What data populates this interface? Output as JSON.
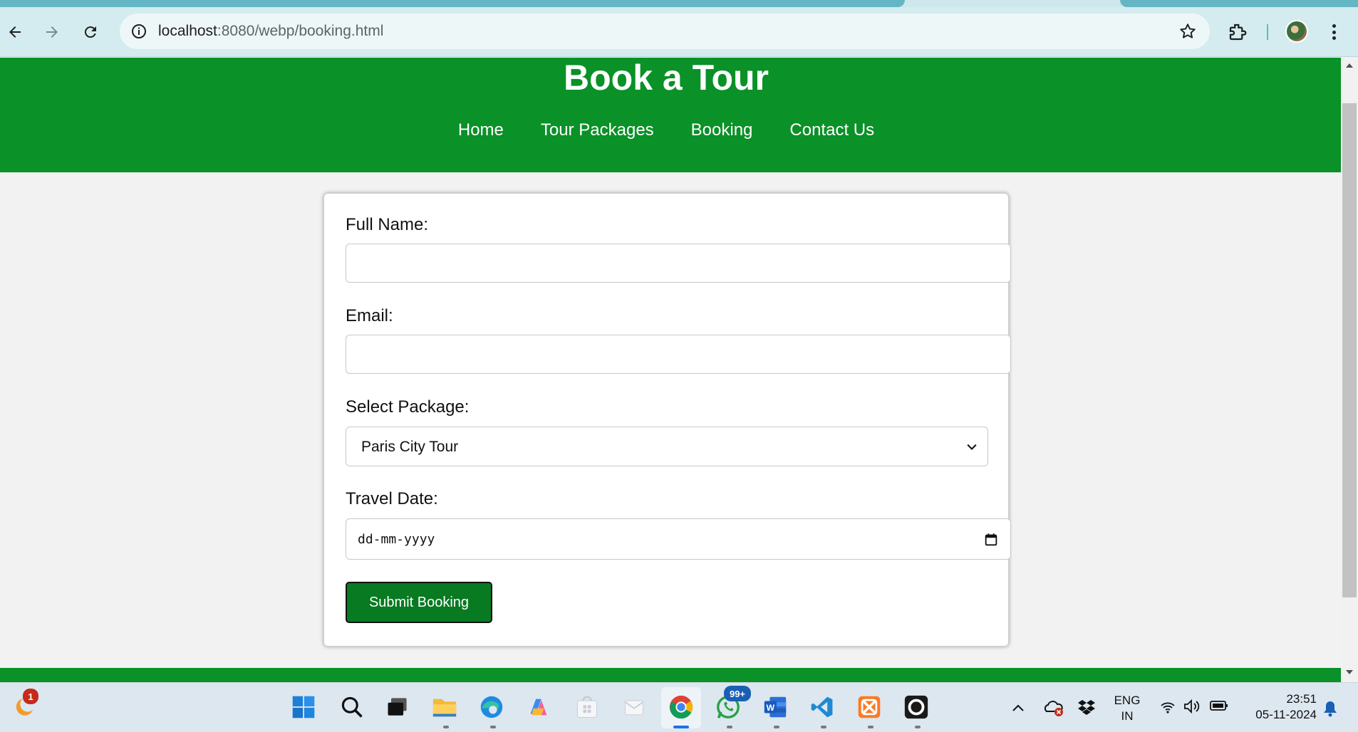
{
  "browser": {
    "url_host": "localhost",
    "url_path": ":8080/webp/booking.html"
  },
  "site": {
    "title": "Book a Tour",
    "nav": [
      "Home",
      "Tour Packages",
      "Booking",
      "Contact Us"
    ]
  },
  "form": {
    "full_name_label": "Full Name:",
    "full_name_value": "",
    "email_label": "Email:",
    "email_value": "",
    "package_label": "Select Package:",
    "package_selected": "Paris City Tour",
    "date_label": "Travel Date:",
    "date_placeholder": "dd-mm-yyyy",
    "submit_label": "Submit Booking"
  },
  "taskbar": {
    "widget_badge": "1",
    "whatsapp_badge": "99+",
    "lang_top": "ENG",
    "lang_bottom": "IN",
    "time": "23:51",
    "date": "05-11-2024"
  },
  "colors": {
    "header_green": "#0a9127",
    "button_green": "#087a21",
    "toolbar": "#d4ecef"
  }
}
